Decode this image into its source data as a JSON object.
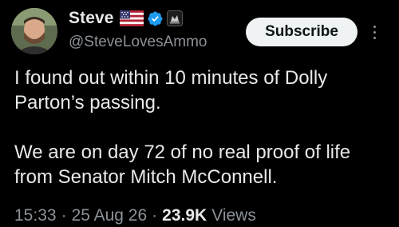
{
  "author": {
    "display_name": "Steve",
    "handle": "@SteveLovesAmmo",
    "badges": [
      "us-flag-icon",
      "verified-icon",
      "affiliate-badge-icon"
    ]
  },
  "subscribe_label": "Subscribe",
  "tweet": {
    "paragraphs": [
      "I found out within 10 minutes of Dolly Parton’s passing.",
      "We are on day 72 of no real proof of life from Senator Mitch McConnell."
    ]
  },
  "meta": {
    "time": "15:33",
    "separator": "·",
    "date": "25 Aug 26",
    "views_count": "23.9K",
    "views_label": "Views"
  },
  "colors": {
    "background": "#000000",
    "text": "#e7e9ea",
    "secondary_text": "#8b9298",
    "verified": "#1d9bf0",
    "button_bg": "#eff3f4"
  }
}
